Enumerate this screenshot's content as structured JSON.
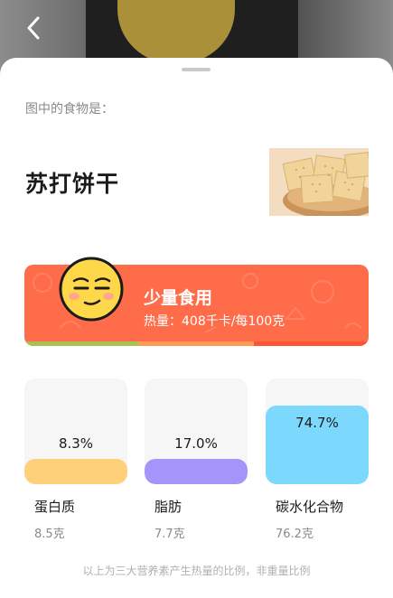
{
  "header": {
    "back_icon": "chevron-left-icon"
  },
  "result": {
    "prompt": "图中的食物是：",
    "food_name": "苏打饼干"
  },
  "recommendation": {
    "title": "少量食用",
    "calories_text": "热量：408千卡/每100克",
    "face_icon": "smirk-face-icon",
    "colors": {
      "card": "#ff6c4a",
      "green": "#a9c251",
      "orange": "#ff9a54",
      "red": "#ff5336"
    }
  },
  "nutrients": [
    {
      "name": "蛋白质",
      "percent": "8.3%",
      "amount": "8.5克",
      "share": 0.083,
      "color": "#ffd07a"
    },
    {
      "name": "脂肪",
      "percent": "17.0%",
      "amount": "7.7克",
      "share": 0.17,
      "color": "#a594f9"
    },
    {
      "name": "碳水化合物",
      "percent": "74.7%",
      "amount": "76.2克",
      "share": 0.747,
      "color": "#7dd8fd"
    }
  ],
  "footnote": "以上为三大营养素产生热量的比例，非重量比例"
}
